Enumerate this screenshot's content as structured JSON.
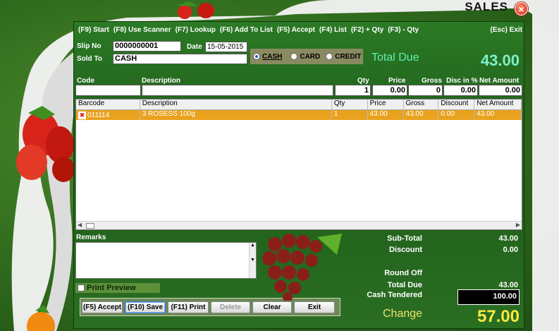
{
  "window": {
    "title": "SALES",
    "close_icon": "close-icon"
  },
  "menubar": {
    "items": [
      "(F9) Start",
      "(F8) Use Scanner",
      "(F7) Lookup",
      "(F6) Add To List",
      "(F5) Accept",
      "(F4) List",
      "(F2) + Qty",
      "(F3) - Qty"
    ],
    "exit": "(Esc) Exit"
  },
  "header": {
    "slip_no_label": "Slip No",
    "slip_no": "0000000001",
    "date_label": "Date",
    "date": "15-05-2015",
    "sold_to_label": "Sold To",
    "sold_to": "CASH",
    "payment": {
      "cash": "CASH",
      "card": "CARD",
      "credit": "CREDIT",
      "selected": "CASH"
    },
    "total_due_label": "Total Due",
    "total_due": "43.00"
  },
  "entry": {
    "code_label": "Code",
    "description_label": "Description",
    "qty_label": "Qty",
    "price_label": "Price",
    "gross_label": "Gross",
    "disc_label": "Disc in %",
    "net_label": "Net Amount",
    "code": "",
    "description": "",
    "qty": "1",
    "price": "0.00",
    "gross": "0",
    "disc": "0.00",
    "net": "0.00"
  },
  "grid": {
    "columns": [
      "Barcode",
      "Description",
      "Qty",
      "Price",
      "Gross",
      "Discount",
      "Net Amount"
    ],
    "rows": [
      {
        "barcode": "011114",
        "description": "3 ROSESS 100g",
        "qty": "1",
        "price": "43.00",
        "gross": "43.00",
        "discount": "0.00",
        "net": "43.00"
      }
    ]
  },
  "remarks": {
    "label": "Remarks",
    "value": ""
  },
  "print_preview": {
    "label": "Print Preview",
    "checked": false
  },
  "buttons": {
    "accept": "(F5) Accept",
    "save": "(F10) Save",
    "print": "(F11) Print",
    "delete": "Delete",
    "clear": "Clear",
    "exit": "Exit"
  },
  "summary": {
    "subtotal_label": "Sub-Total",
    "subtotal": "43.00",
    "discount_label": "Discount",
    "discount": "0.00",
    "roundoff_label": "Round Off",
    "roundoff": "",
    "total_due_label": "Total Due",
    "total_due": "43.00",
    "cash_tendered_label": "Cash Tendered",
    "cash_tendered": "100.00",
    "change_label": "Change",
    "change": "57.00"
  },
  "colors": {
    "panel": "#1e5c1a",
    "selected_row": "#e9a21e",
    "accent": "#7ff0c8",
    "change": "#f8e840"
  }
}
